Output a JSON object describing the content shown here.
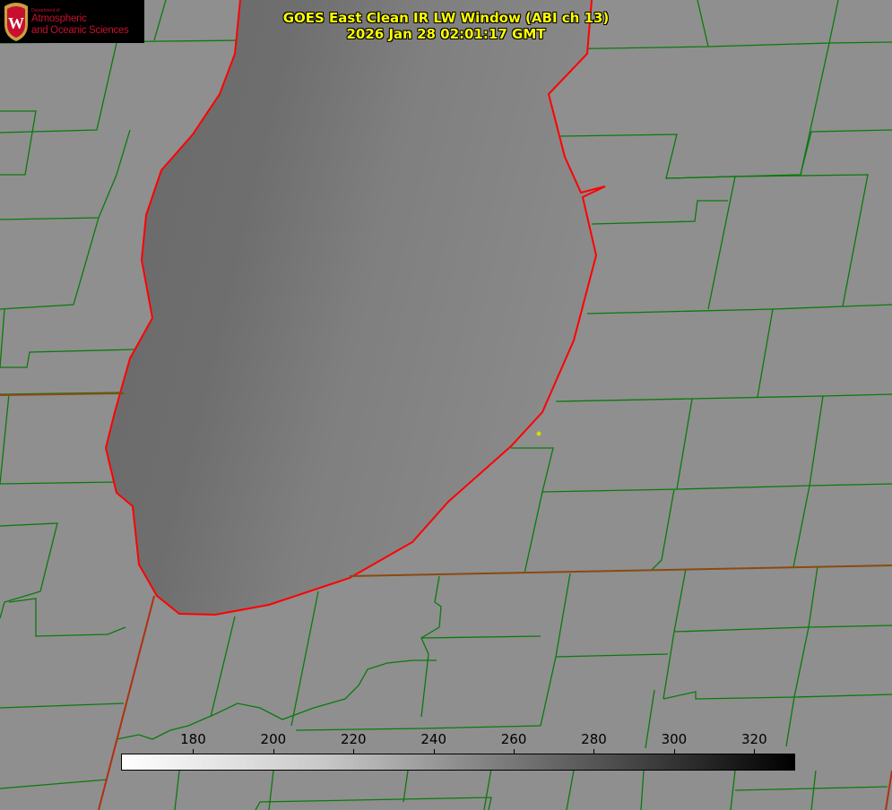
{
  "title": {
    "line1": "GOES East Clean IR LW Window (ABI ch 13)",
    "line2": "2026 Jan 28 02:01:17 GMT"
  },
  "logo": {
    "dept": "Department of",
    "line1": "Atmospheric",
    "line2": "and Oceanic Sciences",
    "emblem": "W"
  },
  "colorbar": {
    "range": [
      162,
      330
    ],
    "ticks": [
      "180",
      "200",
      "220",
      "240",
      "260",
      "280",
      "300",
      "320"
    ],
    "colormap": "white-to-black (inverted gray)"
  },
  "colors": {
    "county_lines": "#0a7a0a",
    "coastline": "#ff0000",
    "title": "#ffff00"
  }
}
